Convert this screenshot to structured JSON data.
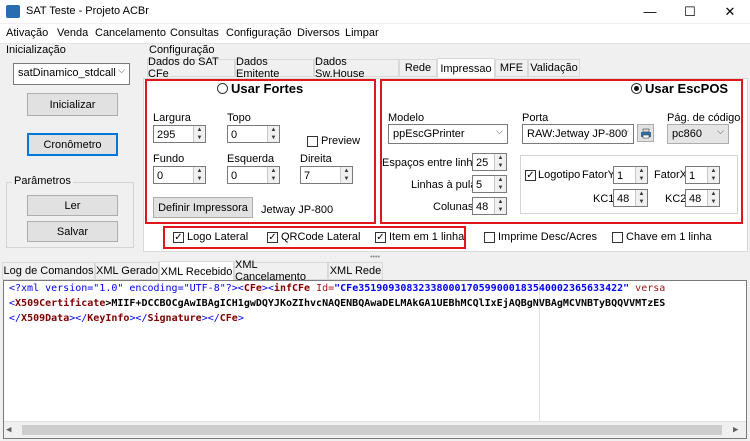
{
  "window": {
    "title": "SAT Teste - Projeto ACBr",
    "minimize": "—",
    "maximize": "☐",
    "close": "✕"
  },
  "menu": [
    "Ativação",
    "Venda",
    "Cancelamento",
    "Consultas",
    "Configuração",
    "Diversos",
    "Limpar"
  ],
  "left": {
    "init_label": "Inicialização",
    "lib_select": "satDinamico_stdcall",
    "init_button": "Inicializar",
    "chrono_button": "Cronômetro",
    "params_label": "Parâmetros",
    "read_button": "Ler",
    "save_button": "Salvar"
  },
  "config": {
    "label": "Configuração",
    "tabs": [
      "Dados do SAT CFe",
      "Dados Emitente",
      "Dados Sw.House",
      "Rede",
      "Impressao",
      "MFE",
      "Validação"
    ],
    "active_tab": "Impressao"
  },
  "fortes": {
    "radio_label": "Usar Fortes",
    "largura_label": "Largura",
    "largura": "295",
    "topo_label": "Topo",
    "topo": "0",
    "preview_label": "Preview",
    "fundo_label": "Fundo",
    "fundo": "0",
    "esquerda_label": "Esquerda",
    "esquerda": "0",
    "direita_label": "Direita",
    "direita": "7",
    "define_button": "Definir Impressora",
    "printer_name": "Jetway JP-800"
  },
  "escpos": {
    "radio_label": "Usar EscPOS",
    "modelo_label": "Modelo",
    "modelo": "ppEscGPrinter",
    "porta_label": "Porta",
    "porta": "RAW:Jetway JP-800",
    "pagcod_label": "Pág. de código",
    "pagcod": "pc860",
    "espacos_label": "Espaços entre linhas",
    "espacos": "25",
    "linhas_label": "Linhas à pular",
    "linhas": "5",
    "colunas_label": "Colunas",
    "colunas": "48",
    "logotipo_label": "Logotipo",
    "fatory_label": "FatorY",
    "fatory": "1",
    "fatorx_label": "FatorX",
    "fatorx": "1",
    "kc1_label": "KC1",
    "kc1": "48",
    "kc2_label": "KC2",
    "kc2": "48"
  },
  "options": {
    "logo_lateral": "Logo Lateral",
    "qrcode_lateral": "QRCode Lateral",
    "item_1_linha": "Item em 1 linha",
    "imprime_desc": "Imprime Desc/Acres",
    "chave_1_linha": "Chave em 1 linha"
  },
  "bottom_tabs": [
    "Log de Comandos",
    "XML Gerado",
    "XML Recebido",
    "XML Cancelamento",
    "XML Rede"
  ],
  "bottom_active": "XML Recebido",
  "xml": {
    "l1a": "<?xml version=\"1.0\" encoding=\"UTF-8\"?><",
    "l1b": "CFe",
    "l1c": "><",
    "l1d": "infCFe",
    "l1e": " Id=",
    "l1f": "\"CFe35190930832338000170599000183540002365633422\"",
    "l1g": " versa",
    "l2a": "<",
    "l2b": "X509Certificate",
    "l2c": ">MIIF+DCCBOCgAwIBAgICH1gwDQYJKoZIhvcNAQENBQAwaDELMAkGA1UEBhMCQlIxEjAQBgNVBAgMCVNBTyBQQVVMTzES",
    "l3a": "</",
    "l3b": "X509Data",
    "l3c": "></",
    "l3d": "KeyInfo",
    "l3e": "></",
    "l3f": "Signature",
    "l3g": "></",
    "l3h": "CFe",
    "l3i": ">"
  }
}
